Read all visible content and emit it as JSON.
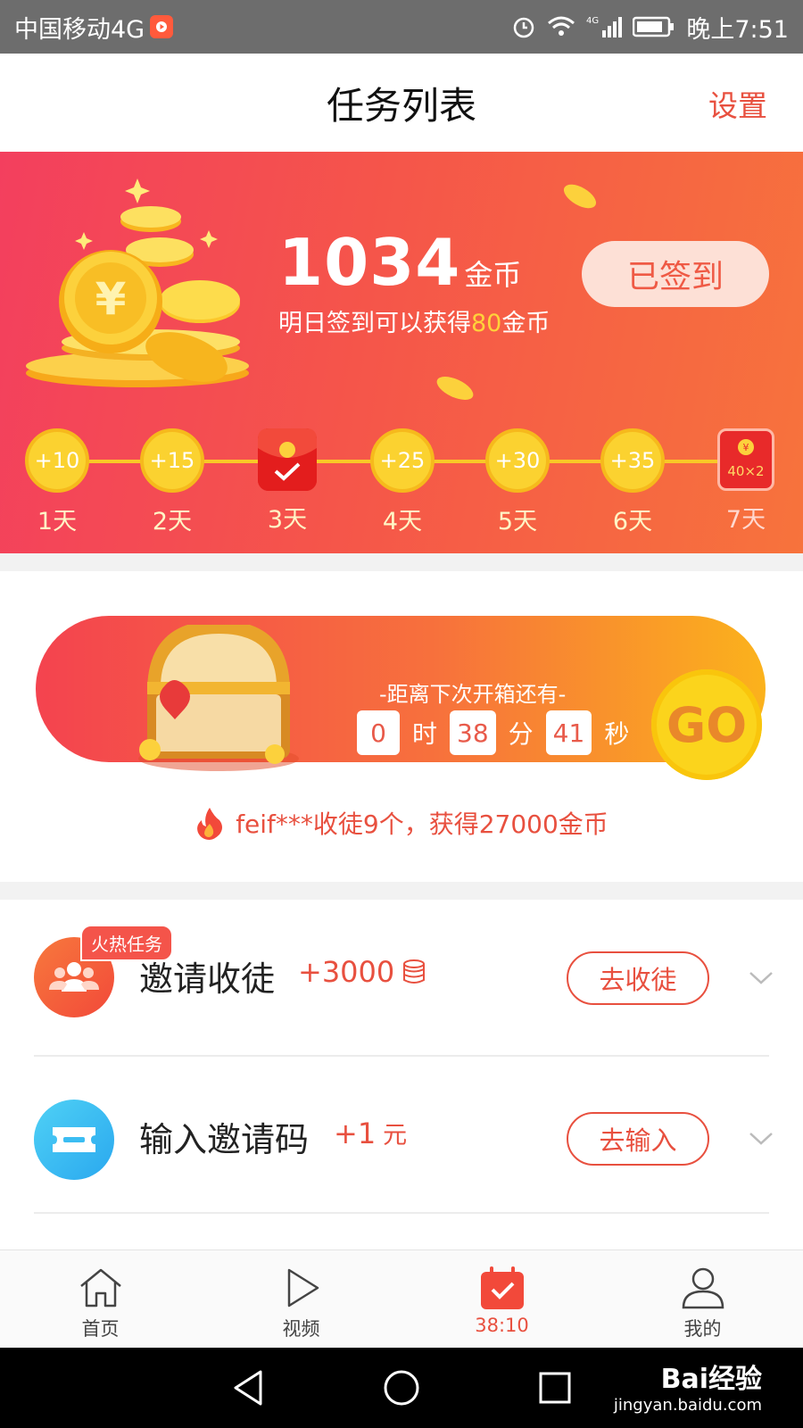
{
  "status_bar": {
    "carrier": "中国移动4G",
    "network": "4G",
    "time": "晚上7:51"
  },
  "header": {
    "title": "任务列表",
    "settings": "设置"
  },
  "signin": {
    "balance": "1034",
    "balance_unit": "金币",
    "hint_prefix": "明日签到可以获得",
    "hint_amount": "80",
    "hint_suffix": "金币",
    "button": "已签到",
    "days": [
      {
        "reward": "+10",
        "label": "1天"
      },
      {
        "reward": "+15",
        "label": "2天"
      },
      {
        "reward": "",
        "label": "3天",
        "state": "signed"
      },
      {
        "reward": "+25",
        "label": "4天"
      },
      {
        "reward": "+30",
        "label": "5天"
      },
      {
        "reward": "+35",
        "label": "6天"
      },
      {
        "reward": "40×2",
        "label": "7天",
        "state": "red-envelope"
      }
    ]
  },
  "chest": {
    "title": "-距离下次开箱还有-",
    "hours": "0",
    "hours_unit": "时",
    "minutes": "38",
    "minutes_unit": "分",
    "seconds": "41",
    "seconds_unit": "秒",
    "go": "GO"
  },
  "news": "feif***收徒9个，获得27000金币",
  "tasks": [
    {
      "tag": "火热任务",
      "name": "邀请收徒",
      "reward": "+3000",
      "action": "去收徒",
      "icon": "users-icon"
    },
    {
      "name": "输入邀请码",
      "reward": "+1",
      "reward_unit": "元",
      "action": "去输入",
      "icon": "ticket-icon"
    }
  ],
  "tabs": [
    {
      "label": "首页",
      "icon": "home-icon"
    },
    {
      "label": "视频",
      "icon": "play-icon"
    },
    {
      "label": "38:10",
      "icon": "calendar-check-icon",
      "active": true
    },
    {
      "label": "我的",
      "icon": "person-icon"
    }
  ],
  "watermark": {
    "brand": "Bai经验",
    "site": "jingyan.baidu.com"
  },
  "colors": {
    "accent": "#e8503f",
    "gold": "#fbd230",
    "banner_start": "#f33f5e",
    "banner_end": "#f7733c"
  }
}
